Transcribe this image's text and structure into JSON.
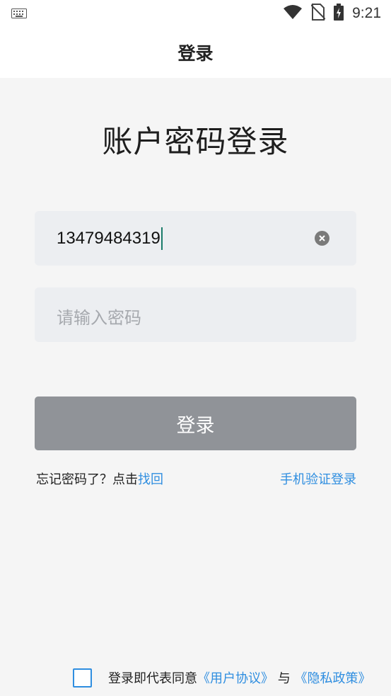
{
  "status_bar": {
    "time": "9:21",
    "icons": [
      "keyboard-icon",
      "wifi-icon",
      "no-sim-icon",
      "battery-charging-icon"
    ]
  },
  "header": {
    "title": "登录"
  },
  "main": {
    "heading": "账户密码登录",
    "phone_field": {
      "value": "13479484319"
    },
    "password_field": {
      "placeholder": "请输入密码"
    },
    "login_button": "登录",
    "forgot_prefix": "忘记密码了？点击",
    "forgot_link": "找回",
    "sms_login_link": "手机验证登录"
  },
  "agreement": {
    "prefix": "登录即代表同意",
    "user_agreement": "《用户协议》",
    "conjunction": " 与 ",
    "privacy_policy": "《隐私政策》"
  },
  "colors": {
    "accent": "#2f8ee0",
    "button_disabled": "#909398",
    "field_bg": "#eceef1",
    "page_bg": "#f5f5f5"
  }
}
